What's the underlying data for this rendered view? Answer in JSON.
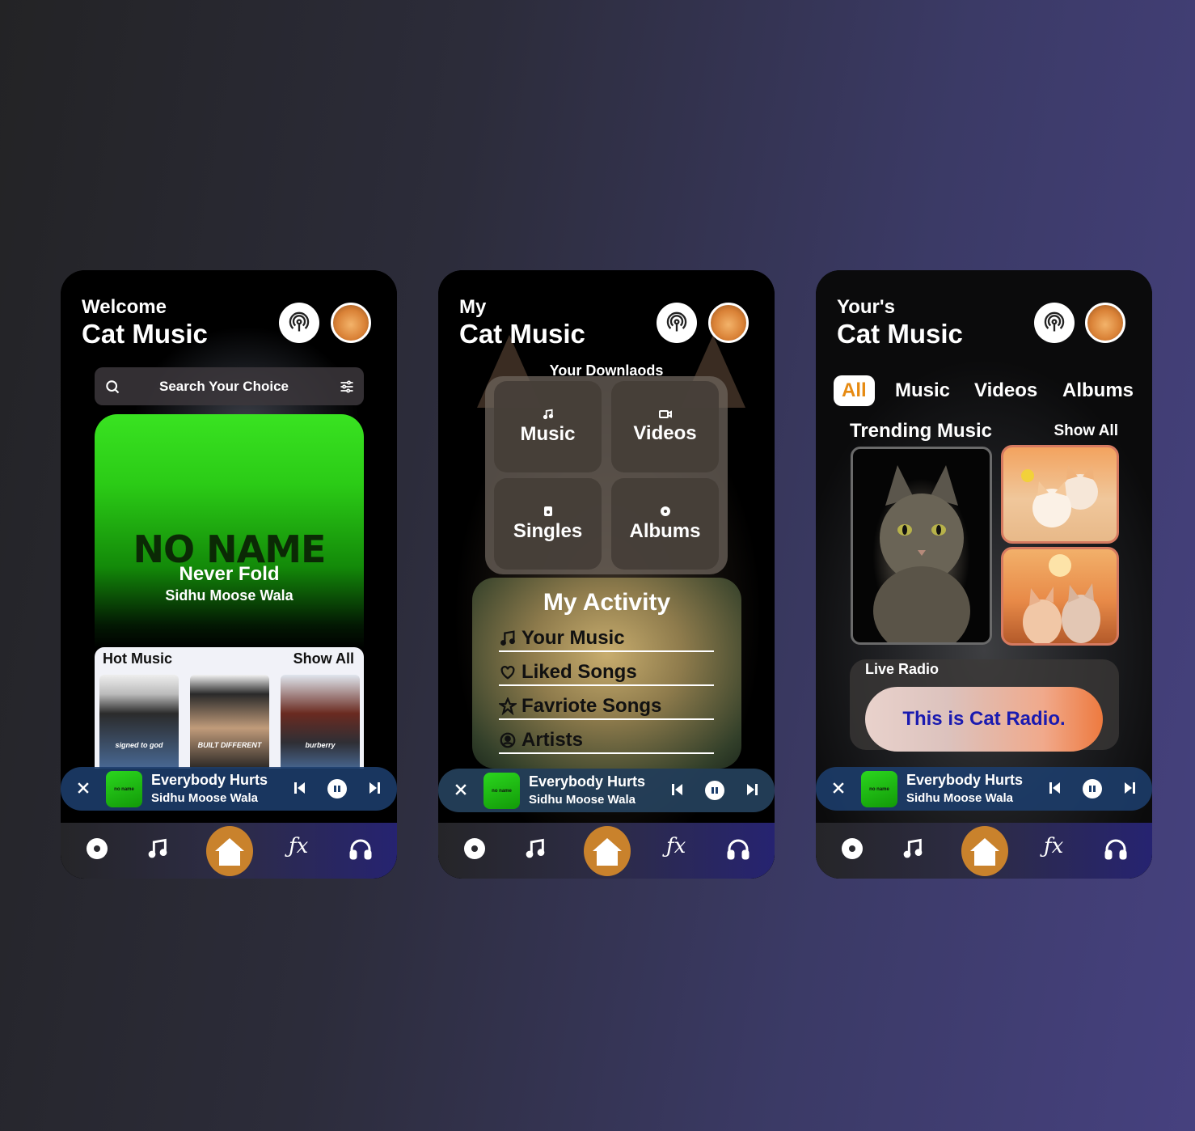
{
  "screens": [
    {
      "title_small": "Welcome",
      "title_large": "Cat Music",
      "search": {
        "placeholder": "Search Your Choice"
      },
      "hero": {
        "art_text": "NO NAME",
        "song": "Never Fold",
        "artist": "Sidhu Moose Wala"
      },
      "hot_music": {
        "title": "Hot Music",
        "show_all": "Show All",
        "albums": [
          {
            "label": "signed to god"
          },
          {
            "label": "BUILT DIFFERENT"
          },
          {
            "label": "burberry"
          }
        ]
      }
    },
    {
      "title_small": "My",
      "title_large": "Cat Music",
      "downloads": {
        "title": "Your Downlaods",
        "tiles": [
          {
            "label": "Music"
          },
          {
            "label": "Videos"
          },
          {
            "label": "Singles"
          },
          {
            "label": "Albums"
          }
        ]
      },
      "activity": {
        "title": "My Activity",
        "items": [
          {
            "label": "Your Music"
          },
          {
            "label": "Liked Songs"
          },
          {
            "label": "Favriote Songs"
          },
          {
            "label": "Artists"
          }
        ]
      }
    },
    {
      "title_small": "Your's",
      "title_large": "Cat Music",
      "chips": [
        {
          "label": "All"
        },
        {
          "label": "Music"
        },
        {
          "label": "Videos"
        },
        {
          "label": "Albums"
        }
      ],
      "trending": {
        "title": "Trending Music",
        "show_all": "Show All"
      },
      "radio": {
        "title": "Live Radio",
        "banner": "This is Cat Radio."
      }
    }
  ],
  "now_playing": {
    "song": "Everybody Hurts",
    "artist": "Sidhu Moose Wala",
    "thumb_text": "no name"
  },
  "nav": [
    "disc-icon",
    "music-note-icon",
    "home-icon",
    "fx-icon",
    "headphones-icon"
  ],
  "nav_fx_label": "ƒx",
  "colors": {
    "accent_orange": "#c9822c",
    "chip_active": "#e68a12",
    "player_bg": "#1c3e6c",
    "radio_text": "#1a1ab0"
  }
}
